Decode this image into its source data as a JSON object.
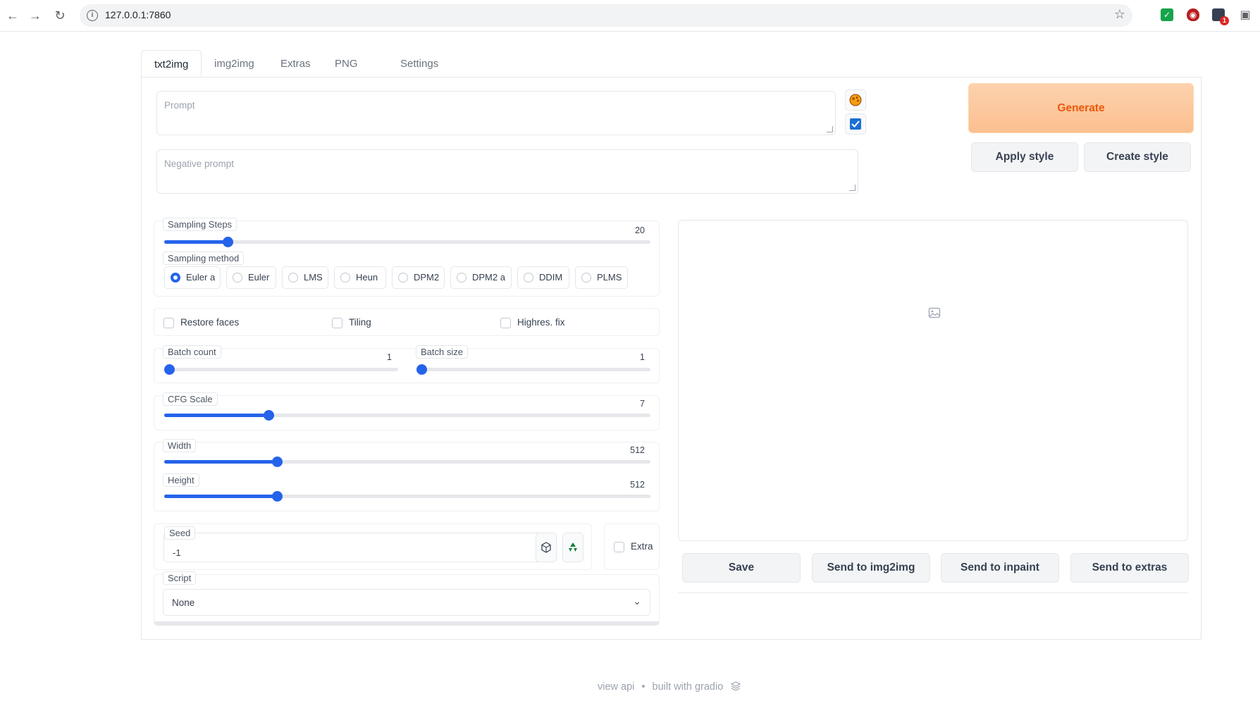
{
  "browser": {
    "url": "127.0.0.1:7860",
    "back_icon": "arrow-left-icon",
    "forward_icon": "arrow-right-icon",
    "reload_icon": "reload-icon",
    "badge_count": "1"
  },
  "tabs": [
    "txt2img",
    "img2img",
    "Extras",
    "PNG Info",
    "Settings"
  ],
  "prompt": {
    "placeholder": "Prompt"
  },
  "negative_prompt": {
    "placeholder": "Negative prompt"
  },
  "buttons": {
    "generate": "Generate",
    "apply_style": "Apply style",
    "create_style": "Create style"
  },
  "sampling_steps": {
    "label": "Sampling Steps",
    "value": "20",
    "fraction": 0.13
  },
  "sampling_method": {
    "label": "Sampling method",
    "options": [
      "Euler a",
      "Euler",
      "LMS",
      "Heun",
      "DPM2",
      "DPM2 a",
      "DDIM",
      "PLMS"
    ],
    "selected": "Euler a"
  },
  "checkboxes": {
    "restore_faces": "Restore faces",
    "tiling": "Tiling",
    "highres_fix": "Highres. fix",
    "extra": "Extra"
  },
  "batch_count": {
    "label": "Batch count",
    "value": "1",
    "fraction": 0.0
  },
  "batch_size": {
    "label": "Batch size",
    "value": "1",
    "fraction": 0.0
  },
  "cfg_scale": {
    "label": "CFG Scale",
    "value": "7",
    "fraction": 0.214
  },
  "width": {
    "label": "Width",
    "value": "512",
    "fraction": 0.232
  },
  "height": {
    "label": "Height",
    "value": "512",
    "fraction": 0.232
  },
  "seed": {
    "label": "Seed",
    "value": "-1"
  },
  "script": {
    "label": "Script",
    "value": "None"
  },
  "output_buttons": {
    "save": "Save",
    "send_img2img": "Send to img2img",
    "send_inpaint": "Send to inpaint",
    "send_extras": "Send to extras"
  },
  "footer": {
    "view_api": "view api",
    "separator": "•",
    "built_with": "built with gradio"
  },
  "colors": {
    "accent": "#2563eb",
    "generate_text": "#ea580c",
    "generate_bg": "#fdd2ae"
  }
}
